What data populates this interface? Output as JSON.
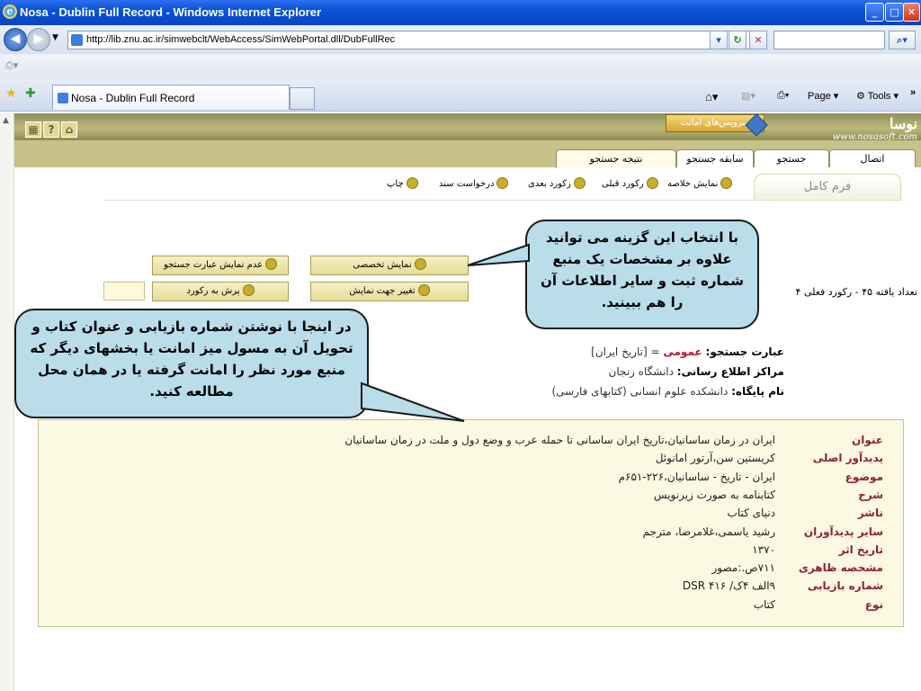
{
  "window": {
    "title": "Nosa - Dublin Full Record - Windows Internet Explorer"
  },
  "browser": {
    "url": "http://lib.znu.ac.ir/simwebclt/WebAccess/SimWebPortal.dll/DubFullRec",
    "tab_title": "Nosa - Dublin Full Record",
    "tools_page": "Page ▾",
    "tools_tools": "Tools ▾"
  },
  "portal": {
    "services_label": "سرویس‌های امانت",
    "logo_name": "نوسا",
    "logo_url": "www.nosasoft.com",
    "tabs": [
      "اتصال",
      "جستجو",
      "سابقه جستجو",
      "نتیجه جستجو"
    ],
    "form_tab": "فرم کامل",
    "actions": [
      "نمایش خلاصه",
      "رکورد قبلی",
      "رکورد بعدی",
      "درخواست سند",
      "چاپ"
    ],
    "buttons": {
      "specialized": "نمایش تخصصی",
      "hide_query": "عدم نمایش عبارت جستجو",
      "change_view": "تغییر جهت نمایش",
      "jump": "پرش به رکورد"
    },
    "counts": "تعداد یافته ۴۵ - رکورد فعلی ۴"
  },
  "query": {
    "label": "عبارت جستجو:",
    "field": "عمومی",
    "value": "= [تاریخ ایران]",
    "centers_label": "مراکز اطلاع رسانی:",
    "centers_value": "دانشگاه زنجان",
    "db_label": "نام پایگاه:",
    "db_value": "دانشکده علوم انسانی (کتابهای فارسی)"
  },
  "record": [
    {
      "label": "عنوان",
      "value": "ایران در زمان ساسانیان،تاریخ ایران ساسانی تا حمله عرب و وضع دول و ملت در زمان ساسانیان"
    },
    {
      "label": "پدیدآور اصلی",
      "value": "کریستین سن،آرتور امانوئل"
    },
    {
      "label": "موضوع",
      "value": "ایران - تاریخ - ساسانیان،۲۲۶-۶۵۱م"
    },
    {
      "label": "شرح",
      "value": "کتابنامه به صورت زیرنویس"
    },
    {
      "label": "ناشر",
      "value": "دنیای کتاب"
    },
    {
      "label": "سایر پدیدآوران",
      "value": "رشید یاسمی،غلامرضا، مترجم"
    },
    {
      "label": "تاریخ اثر",
      "value": "۱۳۷۰"
    },
    {
      "label": "مشخصه ظاهری",
      "value": "۷۱۱ص.:مصور"
    },
    {
      "label": "شماره بازیابی",
      "value": "۹الف ۴ک/ DSR ۴۱۶"
    },
    {
      "label": "نوع",
      "value": "کتاب"
    }
  ],
  "callouts": {
    "specialized": "با انتخاب این گزینه می توانید علاوه بر مشخصات یک منبع شماره ثبت و سایر اطلاعات آن را هم ببینید.",
    "call_number": "در اینجا با نوشتن شماره بازیابی و عنوان کتاب و تحویل آن به مسول میز امانت یا بخشهای دیگر که منبع مورد نظر را امانت گرفته یا در همان محل مطالعه کنید."
  }
}
